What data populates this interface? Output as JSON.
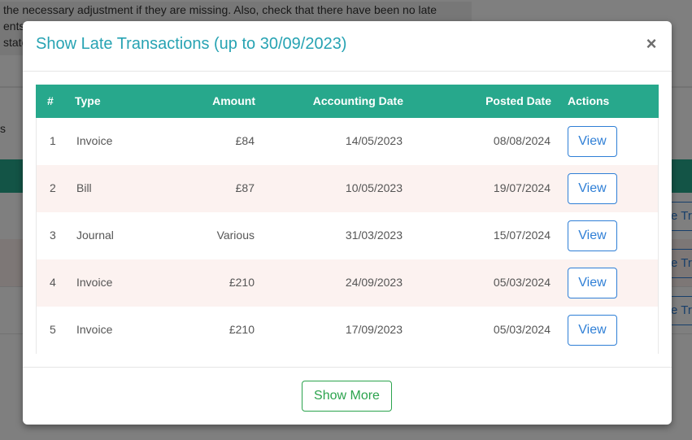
{
  "background": {
    "text_lines": [
      " the necessary adjustment if they are missing. Also, check that there have been no late",
      "ents",
      "state"
    ],
    "side_label": "s",
    "side_buttons": [
      "e Tr",
      "e Tr",
      "e Tr"
    ]
  },
  "modal": {
    "title": "Show Late Transactions (up to 30/09/2023)",
    "close_symbol": "×",
    "columns": [
      "#",
      "Type",
      "Amount",
      "Accounting Date",
      "Posted Date",
      "Actions"
    ],
    "rows": [
      {
        "num": "1",
        "type": "Invoice",
        "amount": "£84",
        "accounting_date": "14/05/2023",
        "posted_date": "08/08/2024",
        "action": "View"
      },
      {
        "num": "2",
        "type": "Bill",
        "amount": "£87",
        "accounting_date": "10/05/2023",
        "posted_date": "19/07/2024",
        "action": "View"
      },
      {
        "num": "3",
        "type": "Journal",
        "amount": "Various",
        "accounting_date": "31/03/2023",
        "posted_date": "15/07/2024",
        "action": "View"
      },
      {
        "num": "4",
        "type": "Invoice",
        "amount": "£210",
        "accounting_date": "24/09/2023",
        "posted_date": "05/03/2024",
        "action": "View"
      },
      {
        "num": "5",
        "type": "Invoice",
        "amount": "£210",
        "accounting_date": "17/09/2023",
        "posted_date": "05/03/2024",
        "action": "View"
      }
    ],
    "footer_button": "Show More"
  },
  "colors": {
    "header_teal": "#27a88c",
    "title": "#27a3b3",
    "view_button": "#2f7fd6",
    "show_more": "#2ba34d",
    "row_alt": "#fcf2f0"
  }
}
